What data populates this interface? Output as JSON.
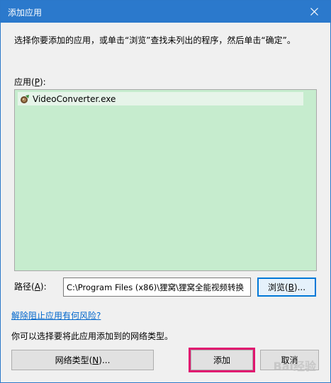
{
  "window": {
    "title": "添加应用",
    "accent_color": "#2b79cc"
  },
  "instruction": "选择你要添加的应用，或单击“浏览”查找未列出的程序，然后单击“确定”。",
  "apps_list": {
    "label_prefix": "应用(",
    "label_key": "P",
    "label_suffix": "):",
    "items": [
      {
        "name": "VideoConverter.exe",
        "icon": "app-exe-icon"
      }
    ],
    "background": "#c6ecce"
  },
  "path": {
    "label_prefix": "路径(",
    "label_key": "A",
    "label_suffix": "):",
    "value": "C:\\Program Files (x86)\\狸窝\\狸窝全能视频转换"
  },
  "buttons": {
    "browse_prefix": "浏览(",
    "browse_key": "B",
    "browse_suffix": ")...",
    "network_prefix": "网络类型(",
    "network_key": "N",
    "network_suffix": ")...",
    "add": "添加",
    "cancel": "取消"
  },
  "risk_link": "解除阻止应用有何风险?",
  "network_description": "你可以选择要将此应用添加到的网络类型。",
  "watermark": "Bai经验",
  "highlight_color": "#e0166f"
}
